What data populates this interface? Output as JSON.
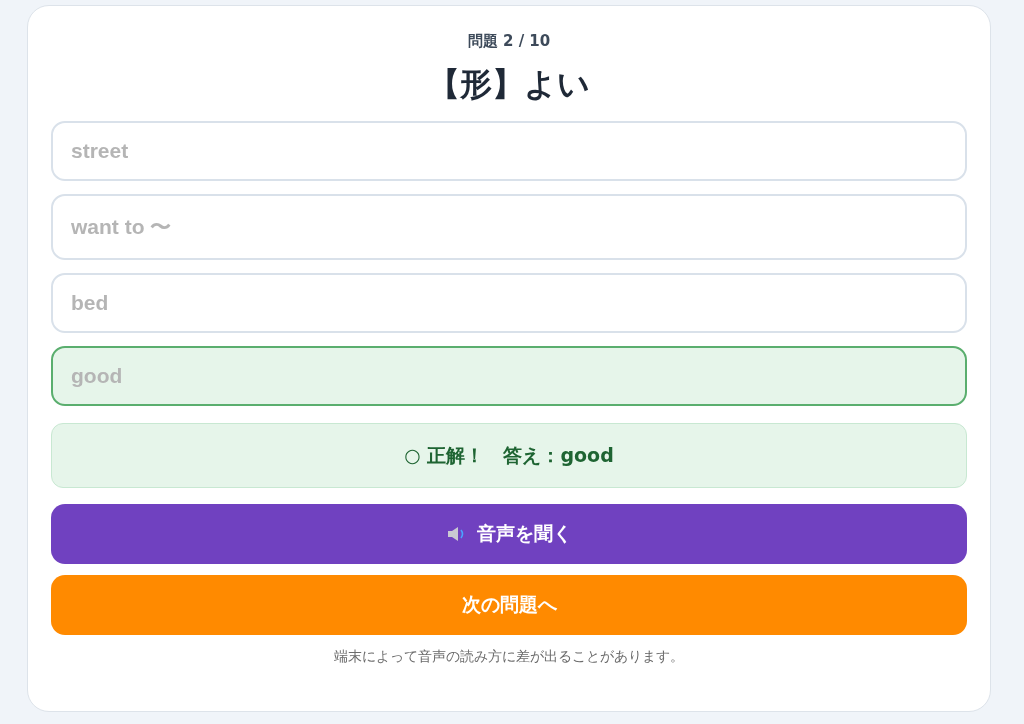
{
  "progress": "問題 2 / 10",
  "question": "【形】よい",
  "options": [
    {
      "label": "street",
      "selected": false
    },
    {
      "label": "want to 〜",
      "selected": false
    },
    {
      "label": "bed",
      "selected": false
    },
    {
      "label": "good",
      "selected": true
    }
  ],
  "feedback": {
    "text": "○ 正解！　答え：**good**"
  },
  "buttons": [
    {
      "kind": "audio",
      "label": "音声を聞く"
    },
    {
      "kind": "next",
      "label": "次の問題へ"
    }
  ],
  "note": "端末によって音声の読み方に差が出ることがあります。"
}
